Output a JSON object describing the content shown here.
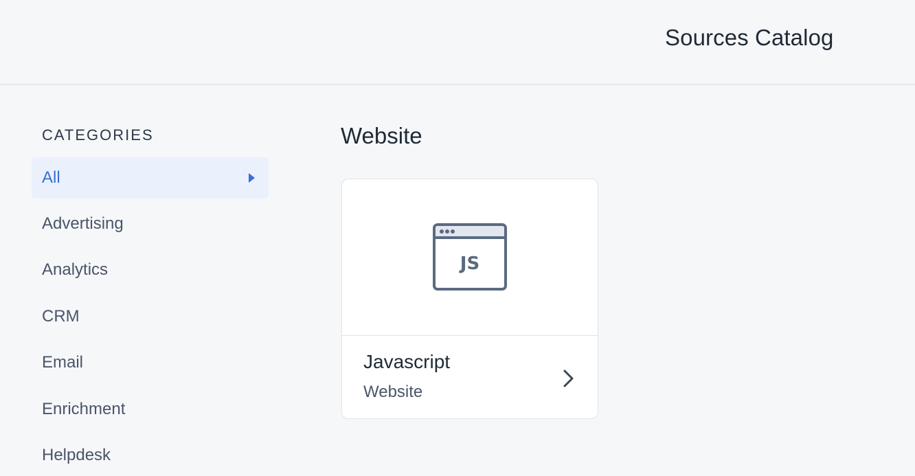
{
  "header": {
    "title": "Sources Catalog"
  },
  "sidebar": {
    "heading": "CATEGORIES",
    "items": [
      {
        "label": "All",
        "active": true
      },
      {
        "label": "Advertising",
        "active": false
      },
      {
        "label": "Analytics",
        "active": false
      },
      {
        "label": "CRM",
        "active": false
      },
      {
        "label": "Email",
        "active": false
      },
      {
        "label": "Enrichment",
        "active": false
      },
      {
        "label": "Helpdesk",
        "active": false
      }
    ]
  },
  "main": {
    "section_title": "Website",
    "cards": [
      {
        "name": "Javascript",
        "category": "Website",
        "icon": "javascript-browser-icon",
        "icon_text": "JS"
      }
    ]
  },
  "colors": {
    "accent": "#3b6fd4",
    "active_bg": "#eaf1fc",
    "icon_stroke": "#5a6a80",
    "page_bg": "#f6f7f9"
  }
}
